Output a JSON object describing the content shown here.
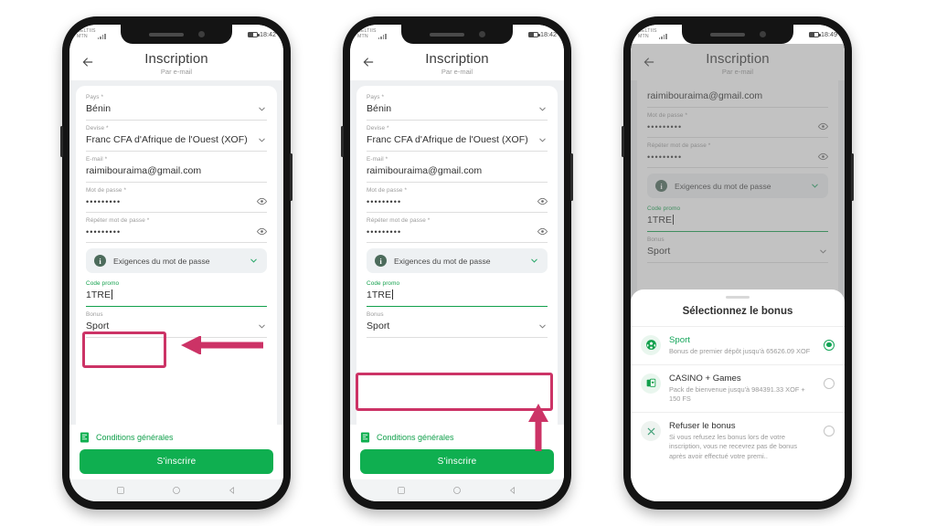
{
  "phones": [
    {
      "id": "phone-promo-highlight",
      "status": {
        "carrier_line1": "CELTIIS",
        "carrier_line2": "MTN",
        "time": "18:42"
      },
      "header": {
        "title": "Inscription",
        "subtitle": "Par e-mail"
      },
      "fields": [
        {
          "label": "Pays *",
          "value": "Bénin",
          "control": "chevron-down-icon"
        },
        {
          "label": "Devise *",
          "value": "Franc CFA d'Afrique de l'Ouest (XOF)",
          "control": "chevron-down-icon"
        },
        {
          "label": "E-mail *",
          "value": "raimibouraima@gmail.com",
          "control": "none"
        },
        {
          "label": "Mot de passe *",
          "value": "•••••••••",
          "control": "eye-icon"
        },
        {
          "label": "Répéter mot de passe *",
          "value": "•••••••••",
          "control": "eye-icon"
        }
      ],
      "password_pill": {
        "label": "Exigences du mot de passe",
        "icon": "info-icon",
        "control": "chevron-down-icon"
      },
      "promo": {
        "label": "Code promo",
        "value": "1TRE",
        "active": true
      },
      "bonus": {
        "label": "Bonus",
        "value": "Sport",
        "control": "chevron-down-icon"
      },
      "terms": {
        "label": "Conditions générales",
        "icon": "document-icon"
      },
      "cta": {
        "label": "S'inscrire"
      },
      "annotation": {
        "target": "promo-field",
        "arrow": "left-arrow"
      }
    },
    {
      "id": "phone-bonus-highlight",
      "status": {
        "carrier_line1": "CELTIIS",
        "carrier_line2": "MTN",
        "time": "18:42"
      },
      "header": {
        "title": "Inscription",
        "subtitle": "Par e-mail"
      },
      "fields": [
        {
          "label": "Pays *",
          "value": "Bénin",
          "control": "chevron-down-icon"
        },
        {
          "label": "Devise *",
          "value": "Franc CFA d'Afrique de l'Ouest (XOF)",
          "control": "chevron-down-icon"
        },
        {
          "label": "E-mail *",
          "value": "raimibouraima@gmail.com",
          "control": "none"
        },
        {
          "label": "Mot de passe *",
          "value": "•••••••••",
          "control": "eye-icon"
        },
        {
          "label": "Répéter mot de passe *",
          "value": "•••••••••",
          "control": "eye-icon"
        }
      ],
      "password_pill": {
        "label": "Exigences du mot de passe",
        "icon": "info-icon",
        "control": "chevron-down-icon"
      },
      "promo": {
        "label": "Code promo",
        "value": "1TRE",
        "active": true
      },
      "bonus": {
        "label": "Bonus",
        "value": "Sport",
        "control": "chevron-down-icon"
      },
      "terms": {
        "label": "Conditions générales",
        "icon": "document-icon"
      },
      "cta": {
        "label": "S'inscrire"
      },
      "annotation": {
        "target": "bonus-field",
        "arrow": "up-arrow"
      }
    },
    {
      "id": "phone-bonus-sheet",
      "status": {
        "carrier_line1": "CELTIIS",
        "carrier_line2": "MTN",
        "time": "18:49"
      },
      "header": {
        "title": "Inscription",
        "subtitle": "Par e-mail"
      },
      "fields": [
        {
          "label": "E-mail *",
          "value": "raimibouraima@gmail.com",
          "control": "none"
        },
        {
          "label": "Mot de passe *",
          "value": "•••••••••",
          "control": "eye-icon"
        },
        {
          "label": "Répéter mot de passe *",
          "value": "•••••••••",
          "control": "eye-icon"
        }
      ],
      "password_pill": {
        "label": "Exigences du mot de passe",
        "icon": "info-icon",
        "control": "chevron-down-icon"
      },
      "promo": {
        "label": "Code promo",
        "value": "1TRE",
        "active": true
      },
      "bonus": {
        "label": "Bonus",
        "value": "Sport",
        "control": "chevron-down-icon"
      },
      "sheet": {
        "title": "Sélectionnez le bonus",
        "options": [
          {
            "title": "Sport",
            "title_accent": true,
            "desc": "Bonus de premier dépôt jusqu'à 65626.09 XOF",
            "icon": "soccer-ball-icon",
            "selected": true
          },
          {
            "title": "CASINO + Games",
            "title_accent": false,
            "desc": "Pack de bienvenue jusqu'à 984391.33 XOF + 150 FS",
            "icon": "playing-cards-icon",
            "selected": false
          },
          {
            "title": "Refuser le bonus",
            "title_accent": false,
            "desc": "Si vous refusez les bonus lors de votre inscription, vous ne recevrez pas de bonus après avoir effectué votre premi..",
            "icon": "x-icon",
            "selected": false
          }
        ]
      }
    }
  ],
  "navbar": {
    "recent": "square-icon",
    "home": "circle-icon",
    "back": "triangle-back-icon"
  },
  "colors": {
    "accent_green": "#0FAF50",
    "annotation_pink": "#CC3366",
    "label_grey": "#9b9b9b",
    "text_dark": "#2f2f2f"
  }
}
